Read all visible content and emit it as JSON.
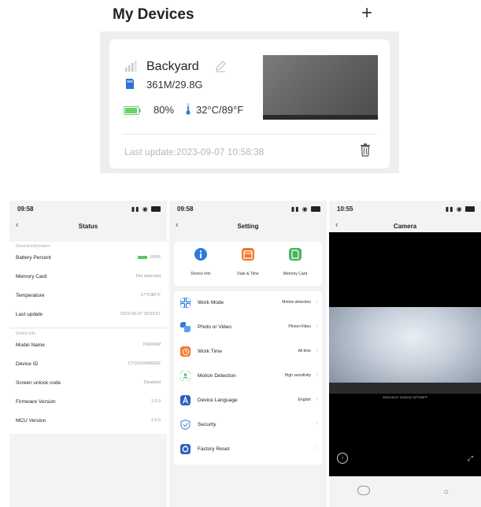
{
  "devices_screen": {
    "title": "My Devices",
    "add_label": "+",
    "device": {
      "name": "Backyard",
      "storage": "361M/29.8G",
      "battery": "80%",
      "temperature": "32°C/89°F",
      "last_update": "Last update:2023-09-07 10:58:38"
    }
  },
  "status_screen": {
    "time": "09:58",
    "title": "Status",
    "general_header": "General information",
    "general": [
      {
        "label": "Battery Percent",
        "value": "100%"
      },
      {
        "label": "Memory Card",
        "value": "Not detected"
      },
      {
        "label": "Temperature",
        "value": "27°C/80°F"
      },
      {
        "label": "Last update",
        "value": "2023-09-07 09:52:57"
      }
    ],
    "device_header": "Device Info",
    "device": [
      {
        "label": "Model Name",
        "value": "PR600W"
      },
      {
        "label": "Device ID",
        "value": "CY10160480002"
      },
      {
        "label": "Screen unlock code",
        "value": "Disabled"
      },
      {
        "label": "Firmware Version",
        "value": "1.0.0"
      },
      {
        "label": "MCU Version",
        "value": "1.6.0"
      }
    ]
  },
  "setting_screen": {
    "time": "09:58",
    "title": "Setting",
    "quick": [
      {
        "label": "Device Info",
        "color": "#2d7be0"
      },
      {
        "label": "Date & Time",
        "color": "#f07a2c"
      },
      {
        "label": "Memory Card",
        "color": "#4ab55c"
      }
    ],
    "items": [
      {
        "label": "Work Mode",
        "value": "Motion detection",
        "color": "#2d7be0"
      },
      {
        "label": "Photo or Video",
        "value": "Photo+Video",
        "color": "#2d7be0"
      },
      {
        "label": "Work Time",
        "value": "All time",
        "color": "#f07a2c"
      },
      {
        "label": "Motion Detection",
        "value": "High sensitivity",
        "color": "#4ab55c"
      },
      {
        "label": "Device Language",
        "value": "English",
        "color": "#2d5fc0"
      },
      {
        "label": "Security",
        "value": "",
        "color": "#5a8be0"
      },
      {
        "label": "Factory Reset",
        "value": "",
        "color": "#2d5fc0"
      }
    ]
  },
  "camera_screen": {
    "time": "10:55",
    "title": "Camera",
    "overlay": "2023-09-07 10:55:12  32°C/89°F"
  },
  "colors": {
    "battery_green": "#5cc45c",
    "accent_blue": "#2d7be0"
  }
}
